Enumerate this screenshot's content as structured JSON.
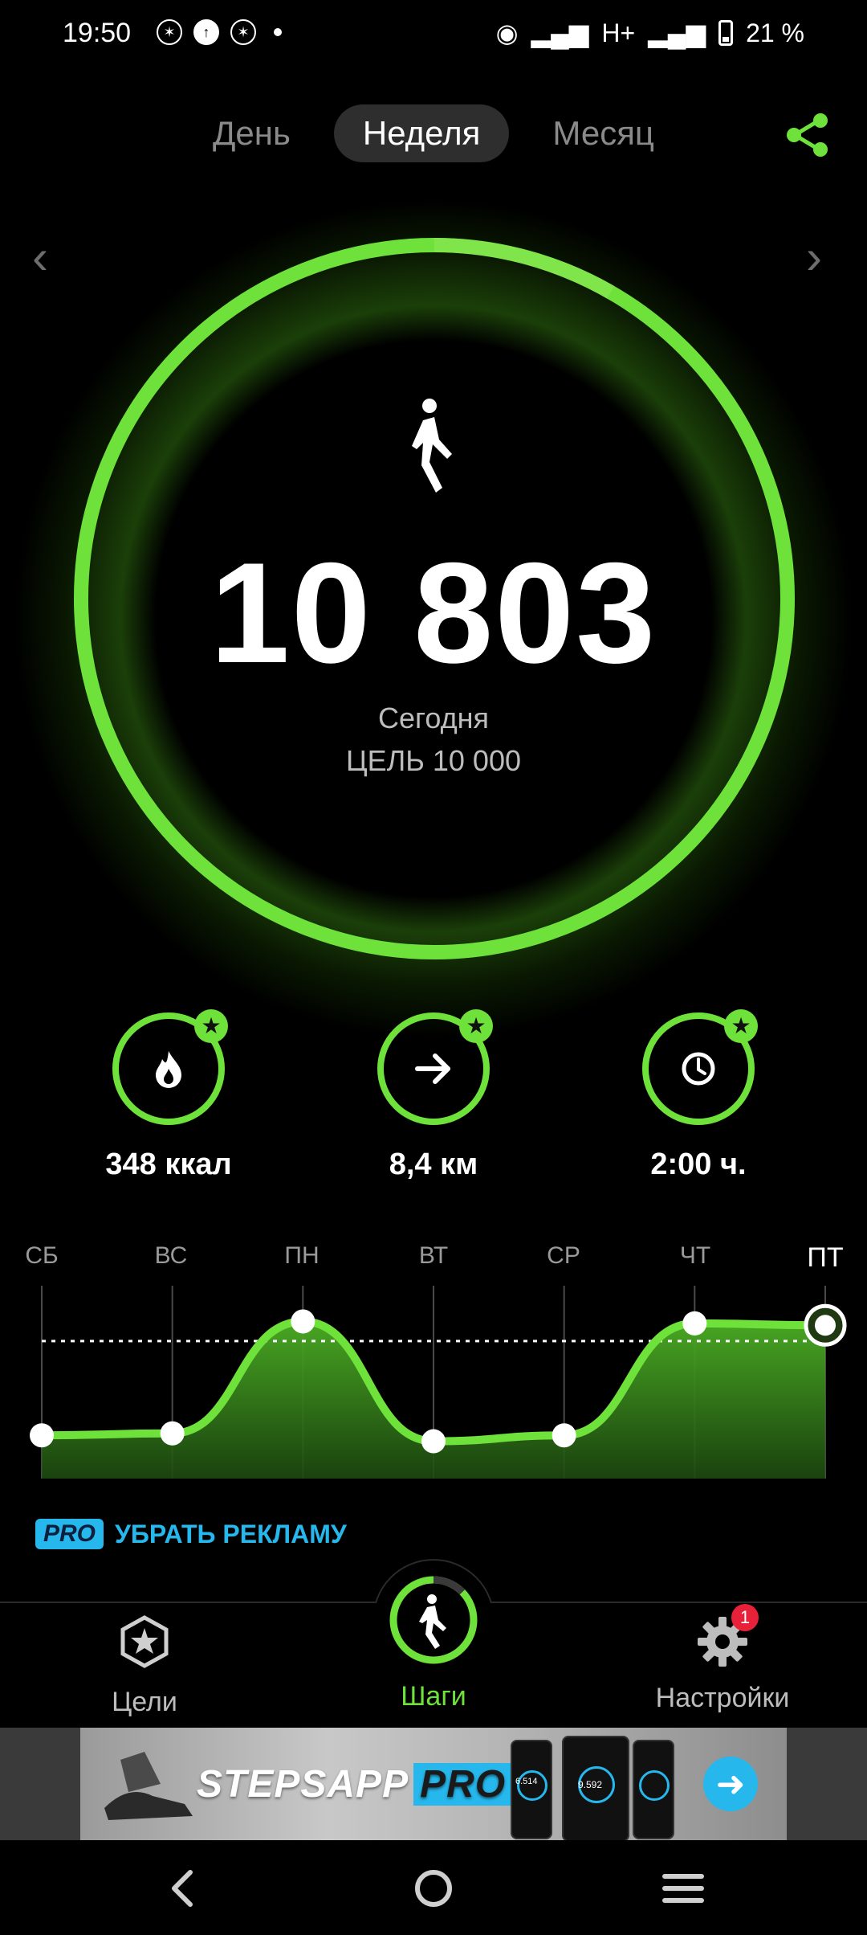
{
  "status_bar": {
    "time": "19:50",
    "network": "H+",
    "battery": "21 %"
  },
  "tabs": [
    {
      "label": "День",
      "active": false
    },
    {
      "label": "Неделя",
      "active": true
    },
    {
      "label": "Месяц",
      "active": false
    }
  ],
  "icons": {
    "share": "share-icon",
    "prev": "chevron-left-icon",
    "next": "chevron-right-icon",
    "walker": "walker-icon",
    "fire": "flame-icon",
    "distance": "arrow-right-icon",
    "time": "clock-icon",
    "star": "star-icon",
    "gear": "gear-icon"
  },
  "colors": {
    "accent": "#6ee23a",
    "pro": "#26b7ec",
    "badge": "#e8213a",
    "muted": "#8a8a8a"
  },
  "progress": {
    "steps_value": "10 803",
    "period": "Сегодня",
    "goal": "ЦЕЛЬ 10 000",
    "ring_fraction": 1.0
  },
  "stats": [
    {
      "value": "348 ккал",
      "icon": "flame-icon"
    },
    {
      "value": "8,4 км",
      "icon": "arrow-right-icon"
    },
    {
      "value": "2:00 ч.",
      "icon": "clock-icon"
    }
  ],
  "chart_data": {
    "type": "area",
    "categories": [
      "СБ",
      "ВС",
      "ПН",
      "ВТ",
      "СР",
      "ЧТ",
      "ПТ"
    ],
    "current_index": 6,
    "values": [
      5200,
      5300,
      11000,
      4900,
      5200,
      10900,
      10803
    ],
    "goal_line": 10000,
    "ylim": [
      3000,
      12000
    ],
    "xlabel": "",
    "ylabel": ""
  },
  "promo": {
    "badge": "PRO",
    "text": "УБРАТЬ РЕКЛАМУ"
  },
  "bottom_nav": [
    {
      "label": "Цели",
      "icon": "star-icon",
      "active": false
    },
    {
      "label": "Шаги",
      "icon": "walker-icon",
      "active": true
    },
    {
      "label": "Настройки",
      "icon": "gear-icon",
      "active": false,
      "badge": "1"
    }
  ],
  "ad": {
    "brand": "STEPSAPP",
    "brand_pro": "PRO",
    "phone_value_1": "6.514",
    "phone_value_2": "9.592"
  }
}
